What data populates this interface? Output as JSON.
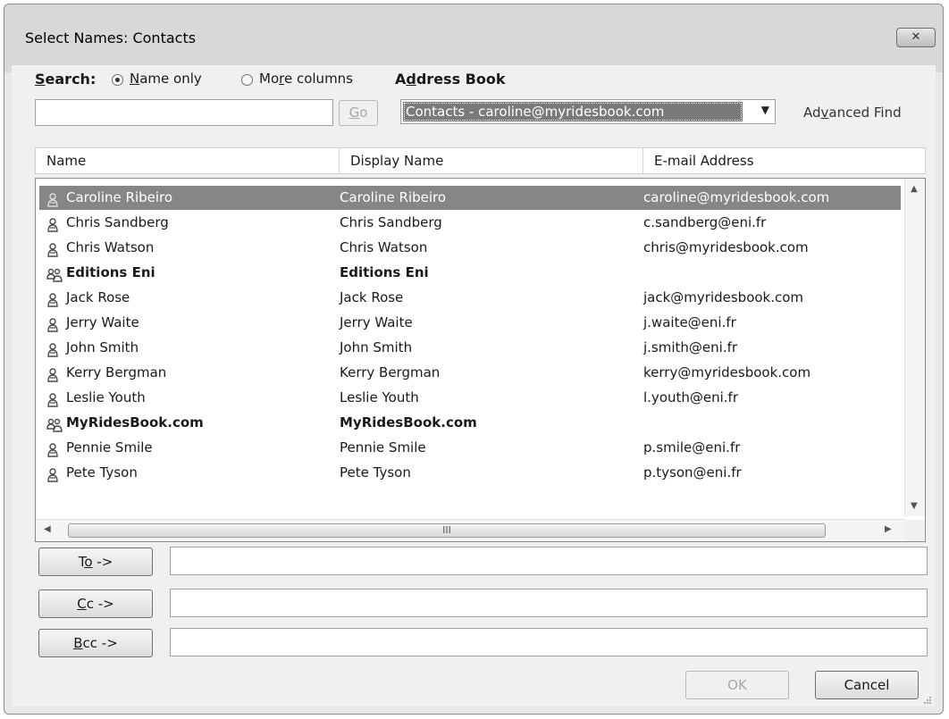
{
  "window": {
    "title": "Select Names: Contacts",
    "close_glyph": "✕"
  },
  "search": {
    "label": "Search:",
    "option_name_only": "Name only",
    "option_more_columns": "More columns",
    "query": "",
    "go_label": "Go"
  },
  "address_book": {
    "label": "Address Book",
    "selected": "Contacts - caroline@myridesbook.com",
    "advanced_find": "Advanced Find"
  },
  "columns": [
    "Name",
    "Display Name",
    "E-mail Address"
  ],
  "contacts": [
    {
      "name": "Caroline Ribeiro",
      "display": "Caroline Ribeiro",
      "email": "caroline@myridesbook.com",
      "kind": "contact-icon"
    },
    {
      "name": "Chris Sandberg",
      "display": "Chris Sandberg",
      "email": "c.sandberg@eni.fr",
      "kind": "contact-icon"
    },
    {
      "name": "Chris Watson",
      "display": "Chris Watson",
      "email": "chris@myridesbook.com",
      "kind": "contact-icon"
    },
    {
      "name": "Editions Eni",
      "display": "Editions Eni",
      "email": "",
      "kind": "group-icon"
    },
    {
      "name": "Jack Rose",
      "display": "Jack Rose",
      "email": "jack@myridesbook.com",
      "kind": "contact-icon"
    },
    {
      "name": "Jerry Waite",
      "display": "Jerry Waite",
      "email": "j.waite@eni.fr",
      "kind": "contact-icon"
    },
    {
      "name": "John Smith",
      "display": "John Smith",
      "email": "j.smith@eni.fr",
      "kind": "contact-icon"
    },
    {
      "name": "Kerry Bergman",
      "display": "Kerry Bergman",
      "email": "kerry@myridesbook.com",
      "kind": "contact-icon"
    },
    {
      "name": "Leslie Youth",
      "display": "Leslie Youth",
      "email": "l.youth@eni.fr",
      "kind": "contact-icon"
    },
    {
      "name": "MyRidesBook.com",
      "display": "MyRidesBook.com",
      "email": "",
      "kind": "group-icon"
    },
    {
      "name": "Pennie Smile",
      "display": "Pennie Smile",
      "email": "p.smile@eni.fr",
      "kind": "contact-icon"
    },
    {
      "name": "Pete Tyson",
      "display": "Pete Tyson",
      "email": "p.tyson@eni.fr",
      "kind": "contact-icon"
    }
  ],
  "selected_index": 0,
  "recipients": {
    "to_label": "To ->",
    "to_value": "",
    "cc_label": "Cc ->",
    "cc_value": "",
    "bcc_label": "Bcc ->",
    "bcc_value": ""
  },
  "footer": {
    "ok_label": "OK",
    "cancel_label": "Cancel"
  },
  "scrollbar": {
    "thumb_grip": "III"
  }
}
